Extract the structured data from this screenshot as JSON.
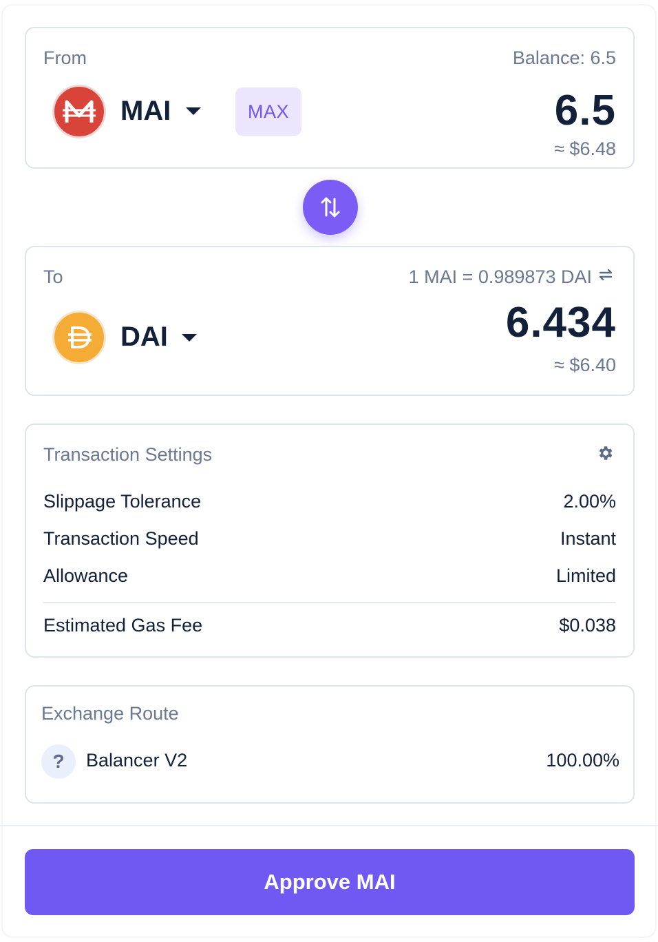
{
  "from": {
    "label": "From",
    "balance": "Balance: 6.5",
    "token": "MAI",
    "icon": "mai-token-icon",
    "max_label": "MAX",
    "amount": "6.5",
    "usd": "≈ $6.48"
  },
  "swap": {
    "icon": "swap-arrows-icon"
  },
  "to": {
    "label": "To",
    "rate": "1 MAI = 0.989873 DAI",
    "rate_icon": "swap-rate-icon",
    "token": "DAI",
    "icon": "dai-token-icon",
    "amount": "6.434",
    "usd": "≈ $6.40"
  },
  "settings": {
    "title": "Transaction Settings",
    "icon": "gear-icon",
    "rows": [
      {
        "label": "Slippage Tolerance",
        "value": "2.00%"
      },
      {
        "label": "Transaction Speed",
        "value": "Instant"
      },
      {
        "label": "Allowance",
        "value": "Limited"
      }
    ],
    "gas": {
      "label": "Estimated Gas Fee",
      "value": "$0.038"
    }
  },
  "route": {
    "title": "Exchange Route",
    "icon": "question-icon",
    "icon_glyph": "?",
    "name": "Balancer V2",
    "percent": "100.00%"
  },
  "approve": {
    "label": "Approve MAI"
  },
  "colors": {
    "accent": "#7059f3",
    "mai": "#d9443a",
    "dai": "#f5ac37"
  }
}
